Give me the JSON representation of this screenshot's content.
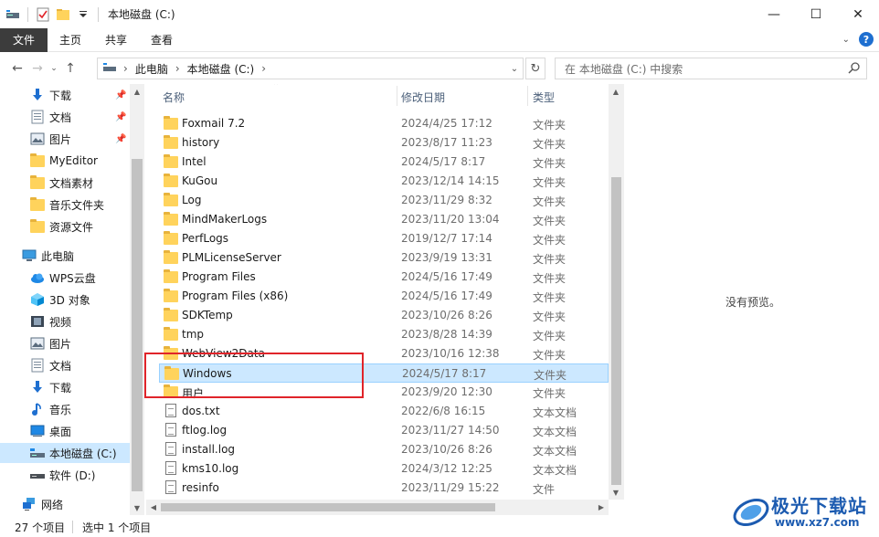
{
  "window": {
    "title": "本地磁盘 (C:)",
    "minimize": "—",
    "maximize": "☐",
    "close": "✕"
  },
  "ribbon": {
    "tabs": [
      "文件",
      "主页",
      "共享",
      "查看"
    ]
  },
  "address": {
    "crumbs": [
      "此电脑",
      "本地磁盘 (C:)"
    ],
    "search_placeholder": "在 本地磁盘 (C:) 中搜索"
  },
  "nav": {
    "quick_access": [
      {
        "label": "下载",
        "icon": "download-arrow-icon",
        "pinned": true
      },
      {
        "label": "文档",
        "icon": "document-icon",
        "pinned": true
      },
      {
        "label": "图片",
        "icon": "picture-icon",
        "pinned": true
      },
      {
        "label": "MyEditor",
        "icon": "folder-icon",
        "pinned": false
      },
      {
        "label": "文档素材",
        "icon": "folder-icon",
        "pinned": false
      },
      {
        "label": "音乐文件夹",
        "icon": "folder-icon",
        "pinned": false
      },
      {
        "label": "资源文件",
        "icon": "folder-icon",
        "pinned": false
      }
    ],
    "this_pc": "此电脑",
    "pc_items": [
      {
        "label": "WPS云盘",
        "icon": "cloud-icon"
      },
      {
        "label": "3D 对象",
        "icon": "3d-objects-icon"
      },
      {
        "label": "视频",
        "icon": "video-icon"
      },
      {
        "label": "图片",
        "icon": "picture-icon"
      },
      {
        "label": "文档",
        "icon": "document-icon"
      },
      {
        "label": "下载",
        "icon": "download-arrow-icon"
      },
      {
        "label": "音乐",
        "icon": "music-note-icon"
      },
      {
        "label": "桌面",
        "icon": "desktop-icon"
      },
      {
        "label": "本地磁盘 (C:)",
        "icon": "drive-c-icon",
        "selected": true
      },
      {
        "label": "软件 (D:)",
        "icon": "drive-icon"
      }
    ],
    "network": "网络"
  },
  "list": {
    "headers": {
      "name": "名称",
      "date": "修改日期",
      "type": "类型"
    },
    "rows": [
      {
        "name": "Foxmail 7.2",
        "date": "2024/4/25 17:12",
        "type": "文件夹",
        "kind": "folder"
      },
      {
        "name": "history",
        "date": "2023/8/17 11:23",
        "type": "文件夹",
        "kind": "folder"
      },
      {
        "name": "Intel",
        "date": "2024/5/17 8:17",
        "type": "文件夹",
        "kind": "folder"
      },
      {
        "name": "KuGou",
        "date": "2023/12/14 14:15",
        "type": "文件夹",
        "kind": "folder"
      },
      {
        "name": "Log",
        "date": "2023/11/29 8:32",
        "type": "文件夹",
        "kind": "folder"
      },
      {
        "name": "MindMakerLogs",
        "date": "2023/11/20 13:04",
        "type": "文件夹",
        "kind": "folder"
      },
      {
        "name": "PerfLogs",
        "date": "2019/12/7 17:14",
        "type": "文件夹",
        "kind": "folder"
      },
      {
        "name": "PLMLicenseServer",
        "date": "2023/9/19 13:31",
        "type": "文件夹",
        "kind": "folder"
      },
      {
        "name": "Program Files",
        "date": "2024/5/16 17:49",
        "type": "文件夹",
        "kind": "folder"
      },
      {
        "name": "Program Files (x86)",
        "date": "2024/5/16 17:49",
        "type": "文件夹",
        "kind": "folder"
      },
      {
        "name": "SDKTemp",
        "date": "2023/10/26 8:26",
        "type": "文件夹",
        "kind": "folder"
      },
      {
        "name": "tmp",
        "date": "2023/8/28 14:39",
        "type": "文件夹",
        "kind": "folder"
      },
      {
        "name": "WebView2Data",
        "date": "2023/10/16 12:38",
        "type": "文件夹",
        "kind": "folder"
      },
      {
        "name": "Windows",
        "date": "2024/5/17 8:17",
        "type": "文件夹",
        "kind": "folder",
        "selected": true
      },
      {
        "name": "用户",
        "date": "2023/9/20 12:30",
        "type": "文件夹",
        "kind": "folder"
      },
      {
        "name": "dos.txt",
        "date": "2022/6/8 16:15",
        "type": "文本文档",
        "kind": "file"
      },
      {
        "name": "ftlog.log",
        "date": "2023/11/27 14:50",
        "type": "文本文档",
        "kind": "file"
      },
      {
        "name": "install.log",
        "date": "2023/10/26 8:26",
        "type": "文本文档",
        "kind": "file"
      },
      {
        "name": "kms10.log",
        "date": "2024/3/12 12:25",
        "type": "文本文档",
        "kind": "file"
      },
      {
        "name": "resinfo",
        "date": "2023/11/29 15:22",
        "type": "文件",
        "kind": "file"
      }
    ]
  },
  "preview": {
    "message": "没有预览。"
  },
  "status": {
    "count": "27 个项目",
    "selected": "选中 1 个项目"
  },
  "watermark": {
    "brand": "极光下载站",
    "url": "www.xz7.com"
  },
  "colors": {
    "selection": "#cce8ff",
    "selection_border": "#99d1ff",
    "highlight_box": "#e0242a",
    "folder": "#ffd35c",
    "file_tab": "#3c3c3c"
  }
}
